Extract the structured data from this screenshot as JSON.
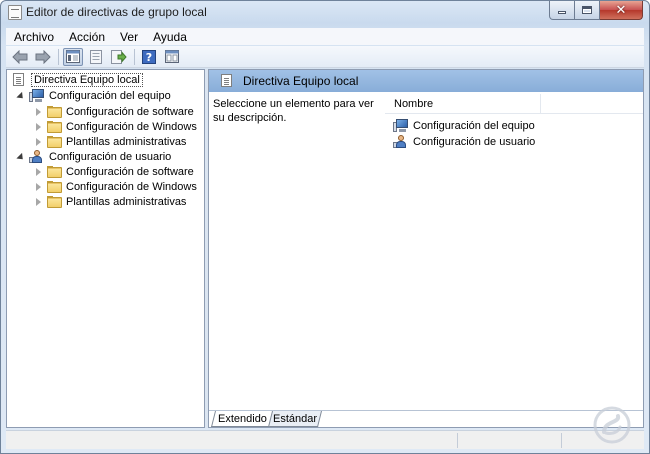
{
  "window": {
    "title": "Editor de directivas de grupo local"
  },
  "menu": {
    "items": [
      "Archivo",
      "Acción",
      "Ver",
      "Ayuda"
    ]
  },
  "toolbar": {
    "buttons": [
      "back-arrow-icon",
      "forward-arrow-icon",
      "show-tree-icon",
      "properties-icon",
      "export-icon",
      "help-icon",
      "console-view-icon"
    ]
  },
  "tree": {
    "root": "Directiva Equipo local",
    "computer": {
      "label": "Configuración del equipo",
      "children": [
        "Configuración de software",
        "Configuración de Windows",
        "Plantillas administrativas"
      ]
    },
    "user": {
      "label": "Configuración de usuario",
      "children": [
        "Configuración de software",
        "Configuración de Windows",
        "Plantillas administrativas"
      ]
    }
  },
  "content": {
    "header": "Directiva Equipo local",
    "description": "Seleccione un elemento para ver su descripción.",
    "column_name": "Nombre",
    "rows": [
      "Configuración del equipo",
      "Configuración de usuario"
    ]
  },
  "tabs": {
    "extended": "Extendido",
    "standard": "Estándar"
  },
  "colors": {
    "header_blue": "#94b7df",
    "folder": "#f2cf6a"
  }
}
